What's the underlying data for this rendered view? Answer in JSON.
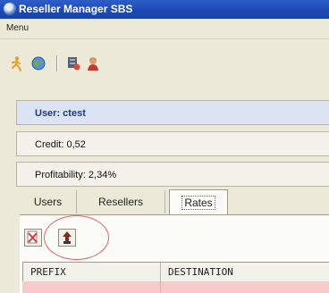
{
  "window": {
    "title": "Reseller Manager SBS"
  },
  "menu": {
    "items": [
      "Menu"
    ]
  },
  "toolbar": {
    "icons": [
      "run-icon",
      "globe-icon",
      "server-icon",
      "user-icon"
    ]
  },
  "info": {
    "user": "User: ctest",
    "credit": "Credit: 0,52",
    "profitability": "Profitability: 2,34%"
  },
  "tabs": [
    {
      "label": "Users",
      "selected": false
    },
    {
      "label": "Resellers",
      "selected": false
    },
    {
      "label": "Rates",
      "selected": true
    }
  ],
  "rates": {
    "buttons": [
      "delete-rate-icon",
      "upload-rate-icon"
    ],
    "columns": [
      "PREFIX",
      "DESTINATION"
    ],
    "row_highlight_color": "#f7caca",
    "annotation_color": "#e06464"
  }
}
